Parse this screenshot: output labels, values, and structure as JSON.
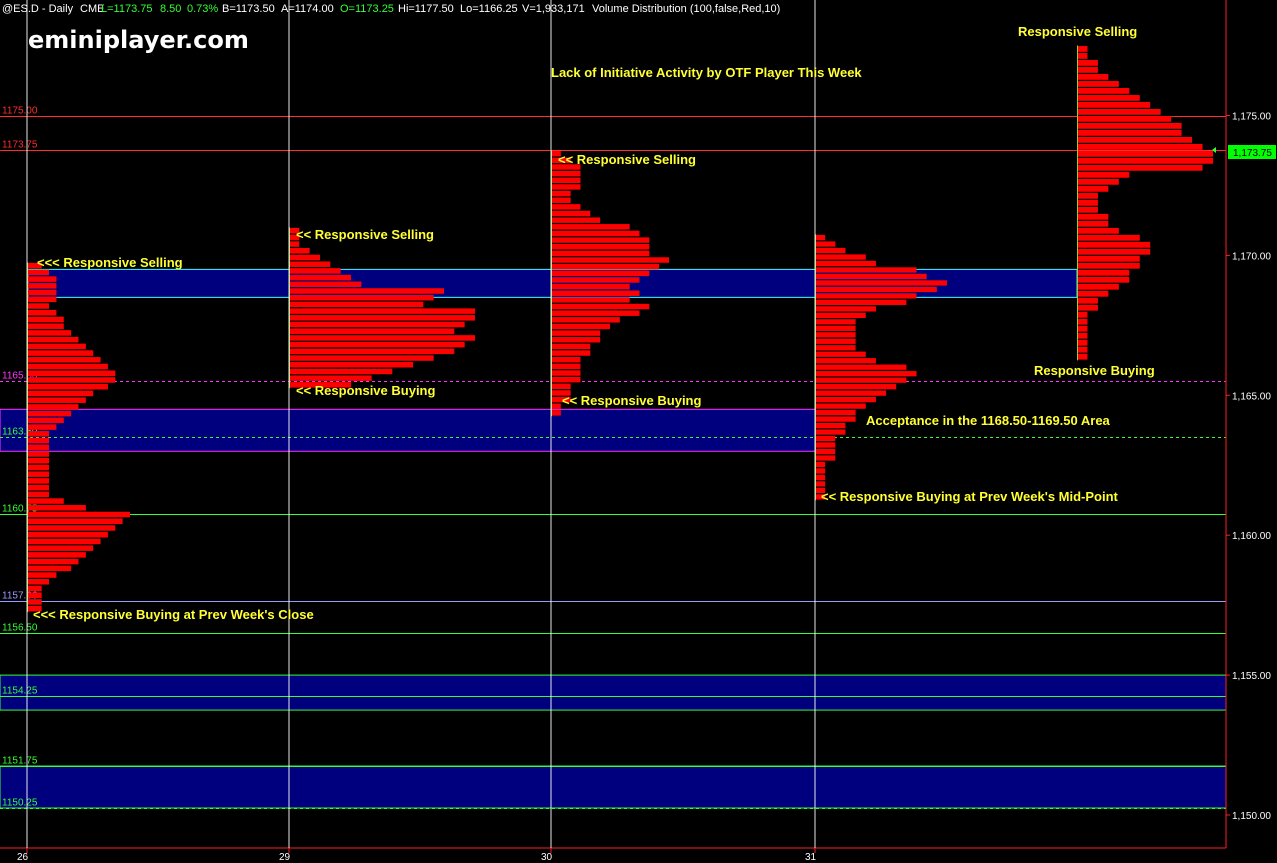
{
  "header": {
    "symbol": "@ES.D - Daily",
    "exchange": "CME",
    "last": "L=1173.75",
    "change": "8.50",
    "change_pct": "0.73%",
    "bid": "B=1173.50",
    "ask": "A=1174.00",
    "open": "O=1173.25",
    "high": "Hi=1177.50",
    "low": "Lo=1166.25",
    "volume": "V=1,933,171",
    "study": "Volume Distribution (100,false,Red,10)"
  },
  "brand": "eminiplayer.com",
  "title": "Lack of Initiative Activity by OTF Player This Week",
  "colors": {
    "background": "#000000",
    "profile_bar": "#ff0000",
    "value_area_fill": "#00007f",
    "annotation": "#ffff33",
    "last_price_badge": "#00ff00"
  },
  "last_price_badge": "1,173.75",
  "chart_data": {
    "type": "bar",
    "orientation": "horizontal volume profiles (volume distribution per day)",
    "title": "Lack of Initiative Activity by OTF Player This Week",
    "xlabel": "",
    "ylabel": "",
    "ylim": [
      1149.6,
      1178.9
    ],
    "y_ticks": [
      1150.0,
      1155.0,
      1160.0,
      1165.0,
      1170.0,
      1175.0
    ],
    "y_tick_labels": [
      "1,150.00",
      "1,155.00",
      "1,160.00",
      "1,165.00",
      "1,170.00",
      "1,175.00"
    ],
    "x_ticks": [
      "26",
      "29",
      "30",
      "31"
    ],
    "levels": [
      {
        "label": "1175.00",
        "price": 1175.0,
        "color": "#ff2d2d",
        "style": "solid"
      },
      {
        "label": "1173.75",
        "price": 1173.75,
        "color": "#ff2d2d",
        "style": "solid"
      },
      {
        "label": "1165.50",
        "price": 1165.5,
        "color": "#ff33ff",
        "style": "dashed"
      },
      {
        "label": "1163.50",
        "price": 1163.5,
        "color": "#33ff33",
        "style": "dashed"
      },
      {
        "label": "1160.75",
        "price": 1160.75,
        "color": "#33ff33",
        "style": "solid"
      },
      {
        "label": "1157.66",
        "price": 1157.66,
        "color": "#9999ff",
        "style": "solid"
      },
      {
        "label": "1156.50",
        "price": 1156.5,
        "color": "#33ff33",
        "style": "solid"
      },
      {
        "label": "1154.25",
        "price": 1154.25,
        "color": "#33ff33",
        "style": "solid"
      },
      {
        "label": "1151.75",
        "price": 1151.75,
        "color": "#33ff33",
        "style": "solid"
      },
      {
        "label": "1150.25",
        "price": 1150.25,
        "color": "#33ff33",
        "style": "dashed"
      }
    ],
    "zones": [
      {
        "from": 1168.5,
        "to": 1169.5,
        "border": "#33ffff"
      },
      {
        "from": 1163.0,
        "to": 1164.5,
        "border": "#ff33ff"
      },
      {
        "from": 1153.75,
        "to": 1155.0,
        "border": "#33ff33"
      },
      {
        "from": 1150.25,
        "to": 1151.75,
        "border": "#33ff33"
      }
    ],
    "profiles": [
      {
        "day": "26",
        "high": 1169.75,
        "low": 1157.25,
        "volumes": [
          2,
          3,
          4,
          4,
          4,
          4,
          3,
          4,
          5,
          5,
          6,
          7,
          8,
          9,
          10,
          11,
          12,
          12,
          11,
          9,
          8,
          7,
          6,
          5,
          4,
          3,
          3,
          3,
          3,
          3,
          3,
          3,
          3,
          3,
          3,
          5,
          8,
          14,
          13,
          12,
          11,
          10,
          9,
          8,
          7,
          6,
          4,
          3,
          2,
          2,
          2,
          2
        ]
      },
      {
        "day": "29",
        "high": 1171.0,
        "low": 1165.25,
        "volumes": [
          1,
          1,
          1,
          2,
          3,
          4,
          5,
          6,
          7,
          15,
          14,
          13,
          18,
          18,
          17,
          16,
          18,
          17,
          16,
          14,
          12,
          10,
          8,
          6
        ]
      },
      {
        "day": "30",
        "high": 1173.75,
        "low": 1164.25,
        "volumes": [
          1,
          2,
          3,
          3,
          3,
          3,
          2,
          2,
          3,
          4,
          5,
          8,
          9,
          10,
          10,
          10,
          12,
          11,
          10,
          9,
          8,
          9,
          8,
          10,
          9,
          7,
          6,
          5,
          5,
          4,
          4,
          3,
          3,
          3,
          3,
          2,
          2,
          2,
          1,
          1
        ]
      },
      {
        "day": "31",
        "high": 1170.75,
        "low": 1161.25,
        "volumes": [
          1,
          2,
          3,
          5,
          6,
          10,
          11,
          13,
          12,
          10,
          9,
          6,
          5,
          4,
          4,
          4,
          4,
          4,
          5,
          6,
          9,
          10,
          9,
          8,
          7,
          6,
          5,
          4,
          4,
          3,
          3,
          2,
          2,
          2,
          2,
          1,
          1,
          1,
          1,
          1,
          1
        ]
      },
      {
        "day": "",
        "high": 1177.5,
        "low": 1166.25,
        "volumes": [
          1,
          1,
          2,
          2,
          3,
          4,
          5,
          6,
          7,
          8,
          9,
          10,
          10,
          11,
          12,
          13,
          13,
          12,
          5,
          4,
          3,
          2,
          2,
          2,
          3,
          3,
          4,
          6,
          7,
          7,
          6,
          6,
          5,
          5,
          4,
          3,
          2,
          2,
          1,
          1,
          1,
          1,
          1,
          1,
          1
        ]
      }
    ],
    "annotations": [
      {
        "text": "<<< Responsive Selling"
      },
      {
        "text": "<<< Responsive Buying at Prev Week's Close"
      },
      {
        "text": "<< Responsive Selling"
      },
      {
        "text": "<< Responsive Buying"
      },
      {
        "text": "<< Responsive Selling"
      },
      {
        "text": "<< Responsive Buying"
      },
      {
        "text": "Acceptance in the 1168.50-1169.50 Area"
      },
      {
        "text": "<< Responsive Buying at Prev Week's Mid-Point"
      },
      {
        "text": "Responsive Selling"
      },
      {
        "text": "Responsive Buying"
      }
    ]
  }
}
